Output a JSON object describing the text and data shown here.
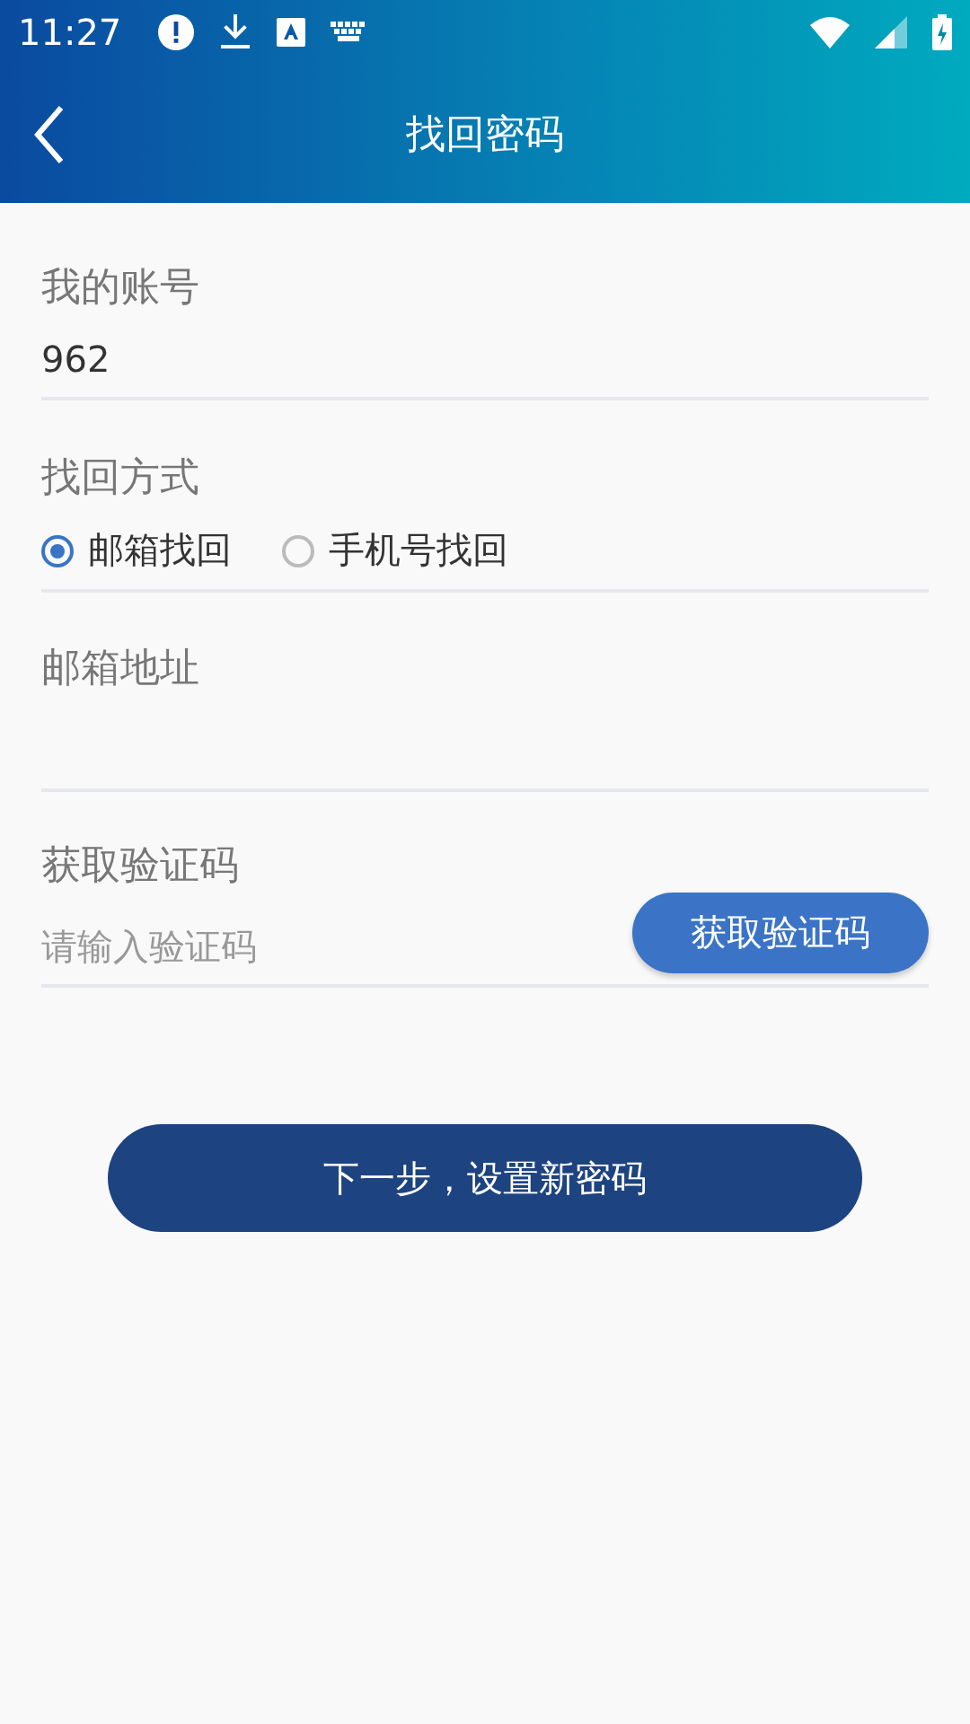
{
  "status_bar": {
    "time": "11:27"
  },
  "app_bar": {
    "title": "找回密码"
  },
  "account": {
    "label": "我的账号",
    "value": "962"
  },
  "method": {
    "label": "找回方式",
    "options": [
      {
        "label": "邮箱找回",
        "selected": true
      },
      {
        "label": "手机号找回",
        "selected": false
      }
    ]
  },
  "email": {
    "label": "邮箱地址"
  },
  "code": {
    "label": "获取验证码",
    "placeholder": "请输入验证码",
    "button": "获取验证码"
  },
  "next_button": "下一步，设置新密码"
}
